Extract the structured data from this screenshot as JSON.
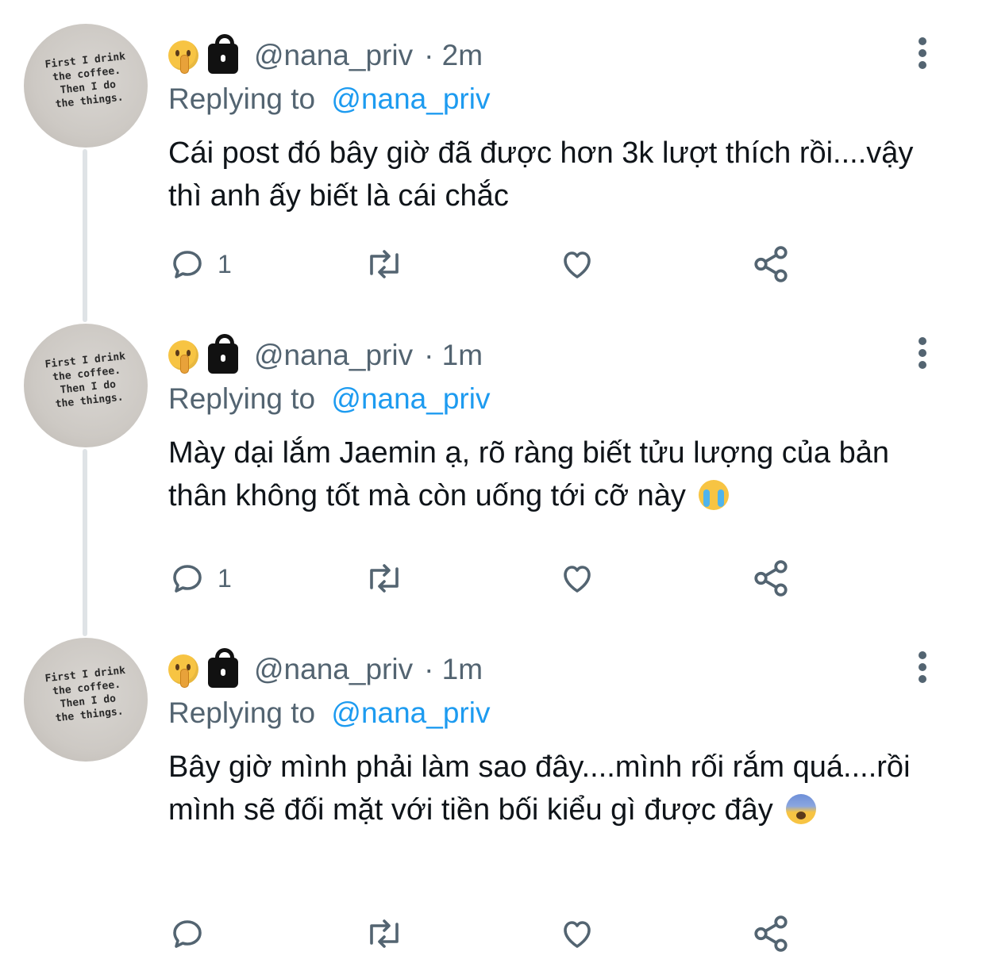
{
  "tweets": [
    {
      "avatar_text": "First I drink\nthe coffee.\nThen I do\nthe things.",
      "handle": "@nana_priv",
      "time": "· 2m",
      "replying_prefix": "Replying to",
      "replying_to": "@nana_priv",
      "text": "Cái post đó bây giờ đã được hơn 3k lượt thích rồi....vậy thì anh ấy biết là cái chắc",
      "emoji": "",
      "reply_count": "1"
    },
    {
      "avatar_text": "First I drink\nthe coffee.\nThen I do\nthe things.",
      "handle": "@nana_priv",
      "time": "· 1m",
      "replying_prefix": "Replying to",
      "replying_to": "@nana_priv",
      "text": "Mày dại lắm Jaemin ạ, rõ ràng biết tửu lượng của bản thân không tốt mà còn uống tới cỡ này",
      "emoji": "loudly-crying-face",
      "reply_count": "1"
    },
    {
      "avatar_text": "First I drink\nthe coffee.\nThen I do\nthe things.",
      "handle": "@nana_priv",
      "time": "· 1m",
      "replying_prefix": "Replying to",
      "replying_to": "@nana_priv",
      "text": "Bây giờ mình phải làm sao đây....mình rối rắm quá....rồi mình sẽ đối mặt với tiền bối kiểu gì được đây",
      "emoji": "fearful-face",
      "reply_count": ""
    }
  ],
  "icons": {
    "header_emoji": "shushing-face",
    "protected": "lock-icon",
    "more": "more-icon",
    "reply": "reply-icon",
    "retweet": "retweet-icon",
    "like": "like-icon",
    "share": "share-icon"
  },
  "colors": {
    "link": "#1d9bf0",
    "secondary_text": "#536471",
    "thread_line": "#dfe3e6"
  }
}
